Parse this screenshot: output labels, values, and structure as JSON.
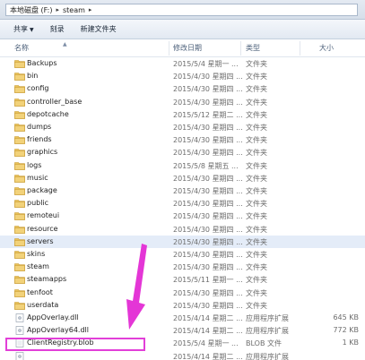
{
  "address": {
    "parts": [
      "本地磁盘 (F:)",
      "steam"
    ]
  },
  "toolbar": {
    "share_label": "共享",
    "burn_label": "刻录",
    "new_folder_label": "新建文件夹"
  },
  "columns": {
    "name": "名称",
    "date": "修改日期",
    "type": "类型",
    "size": "大小"
  },
  "files": [
    {
      "name": "Backups",
      "date": "2015/5/4 星期一 ...",
      "type": "文件夹",
      "size": "",
      "kind": "folder"
    },
    {
      "name": "bin",
      "date": "2015/4/30 星期四 ...",
      "type": "文件夹",
      "size": "",
      "kind": "folder"
    },
    {
      "name": "config",
      "date": "2015/4/30 星期四 ...",
      "type": "文件夹",
      "size": "",
      "kind": "folder"
    },
    {
      "name": "controller_base",
      "date": "2015/4/30 星期四 ...",
      "type": "文件夹",
      "size": "",
      "kind": "folder"
    },
    {
      "name": "depotcache",
      "date": "2015/5/12 星期二 ...",
      "type": "文件夹",
      "size": "",
      "kind": "folder"
    },
    {
      "name": "dumps",
      "date": "2015/4/30 星期四 ...",
      "type": "文件夹",
      "size": "",
      "kind": "folder"
    },
    {
      "name": "friends",
      "date": "2015/4/30 星期四 ...",
      "type": "文件夹",
      "size": "",
      "kind": "folder"
    },
    {
      "name": "graphics",
      "date": "2015/4/30 星期四 ...",
      "type": "文件夹",
      "size": "",
      "kind": "folder"
    },
    {
      "name": "logs",
      "date": "2015/5/8 星期五 ...",
      "type": "文件夹",
      "size": "",
      "kind": "folder"
    },
    {
      "name": "music",
      "date": "2015/4/30 星期四 ...",
      "type": "文件夹",
      "size": "",
      "kind": "folder"
    },
    {
      "name": "package",
      "date": "2015/4/30 星期四 ...",
      "type": "文件夹",
      "size": "",
      "kind": "folder"
    },
    {
      "name": "public",
      "date": "2015/4/30 星期四 ...",
      "type": "文件夹",
      "size": "",
      "kind": "folder"
    },
    {
      "name": "remoteui",
      "date": "2015/4/30 星期四 ...",
      "type": "文件夹",
      "size": "",
      "kind": "folder"
    },
    {
      "name": "resource",
      "date": "2015/4/30 星期四 ...",
      "type": "文件夹",
      "size": "",
      "kind": "folder"
    },
    {
      "name": "servers",
      "date": "2015/4/30 星期四 ...",
      "type": "文件夹",
      "size": "",
      "kind": "folder",
      "selected": true
    },
    {
      "name": "skins",
      "date": "2015/4/30 星期四 ...",
      "type": "文件夹",
      "size": "",
      "kind": "folder"
    },
    {
      "name": "steam",
      "date": "2015/4/30 星期四 ...",
      "type": "文件夹",
      "size": "",
      "kind": "folder"
    },
    {
      "name": "steamapps",
      "date": "2015/5/11 星期一 ...",
      "type": "文件夹",
      "size": "",
      "kind": "folder"
    },
    {
      "name": "tenfoot",
      "date": "2015/4/30 星期四 ...",
      "type": "文件夹",
      "size": "",
      "kind": "folder"
    },
    {
      "name": "userdata",
      "date": "2015/4/30 星期四 ...",
      "type": "文件夹",
      "size": "",
      "kind": "folder"
    },
    {
      "name": "AppOverlay.dll",
      "date": "2015/4/14 星期二 ...",
      "type": "应用程序扩展",
      "size": "645 KB",
      "kind": "dll"
    },
    {
      "name": "AppOverlay64.dll",
      "date": "2015/4/14 星期二 ...",
      "type": "应用程序扩展",
      "size": "772 KB",
      "kind": "dll"
    },
    {
      "name": "ClientRegistry.blob",
      "date": "2015/5/4 星期一 ...",
      "type": "BLOB 文件",
      "size": "1 KB",
      "kind": "blob"
    },
    {
      "name": "",
      "date": "2015/4/14 星期二 ...",
      "type": "应用程序扩展",
      "size": "",
      "kind": "dll"
    }
  ],
  "colors": {
    "highlight": "#e23fd8",
    "arrow": "#e436d6",
    "folder": "#e8c25a",
    "selected_row": "#e4ecf8"
  }
}
